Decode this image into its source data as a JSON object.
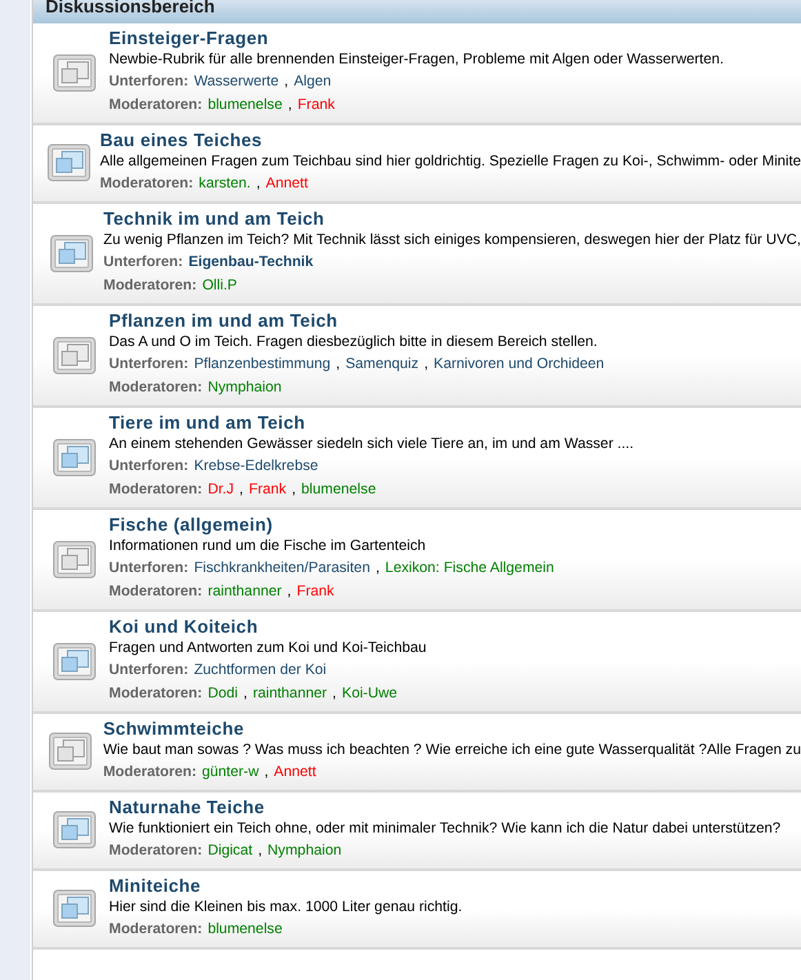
{
  "section": {
    "title": "Diskussionsbereich"
  },
  "separator": ",",
  "forums": [
    {
      "title": "Einsteiger-Fragen",
      "new_posts": false,
      "description": "Newbie-Rubrik für alle brennenden Einsteiger-Fragen, Probleme mit Algen oder Wasserwerten.",
      "subforums": {
        "label": "Unterforen:",
        "items": [
          {
            "name": "Wasserwerte",
            "color": "#1e4a6e",
            "bold": false
          },
          {
            "name": "Algen",
            "color": "#1e4a6e",
            "bold": false
          }
        ]
      },
      "moderators": {
        "label": "Moderatoren:",
        "items": [
          {
            "name": "blumenelse",
            "color": "#008000"
          },
          {
            "name": "Frank",
            "color": "#ff0000"
          }
        ]
      }
    },
    {
      "title": "Bau eines Teiches",
      "new_posts": true,
      "description": "Alle allgemeinen Fragen zum Teichbau sind hier goldrichtig. Spezielle Fragen zu Koi-, Schwimm- oder Minite",
      "moderators": {
        "label": "Moderatoren:",
        "items": [
          {
            "name": "karsten.",
            "color": "#008000"
          },
          {
            "name": "Annett",
            "color": "#ff0000"
          }
        ]
      }
    },
    {
      "title": "Technik im und am Teich",
      "new_posts": true,
      "description": "Zu wenig Pflanzen im Teich? Mit Technik lässt sich einiges kompensieren, deswegen hier der Platz für UVC,",
      "subforums": {
        "label": "Unterforen:",
        "items": [
          {
            "name": "Eigenbau-Technik",
            "color": "#1e4a6e",
            "bold": true
          }
        ]
      },
      "moderators": {
        "label": "Moderatoren:",
        "items": [
          {
            "name": "Olli.P",
            "color": "#008000"
          }
        ]
      }
    },
    {
      "title": "Pflanzen im und am Teich",
      "new_posts": false,
      "description": "Das A und O im Teich. Fragen diesbezüglich bitte in diesem Bereich stellen.",
      "subforums": {
        "label": "Unterforen:",
        "items": [
          {
            "name": "Pflanzenbestimmung",
            "color": "#1e4a6e",
            "bold": false
          },
          {
            "name": "Samenquiz",
            "color": "#1e4a6e",
            "bold": false
          },
          {
            "name": "Karnivoren und Orchideen",
            "color": "#1e4a6e",
            "bold": false
          }
        ]
      },
      "moderators": {
        "label": "Moderatoren:",
        "items": [
          {
            "name": "Nymphaion",
            "color": "#008000"
          }
        ]
      }
    },
    {
      "title": "Tiere im und am Teich",
      "new_posts": true,
      "description": "An einem stehenden Gewässer siedeln sich viele Tiere an, im und am Wasser ....",
      "subforums": {
        "label": "Unterforen:",
        "items": [
          {
            "name": "Krebse-Edelkrebse",
            "color": "#1e4a6e",
            "bold": false
          }
        ]
      },
      "moderators": {
        "label": "Moderatoren:",
        "items": [
          {
            "name": "Dr.J",
            "color": "#ff0000"
          },
          {
            "name": "Frank",
            "color": "#ff0000"
          },
          {
            "name": "blumenelse",
            "color": "#008000"
          }
        ]
      }
    },
    {
      "title": "Fische (allgemein)",
      "new_posts": false,
      "description": "Informationen rund um die Fische im Gartenteich",
      "subforums": {
        "label": "Unterforen:",
        "items": [
          {
            "name": "Fischkrankheiten/Parasiten",
            "color": "#1e4a6e",
            "bold": false
          },
          {
            "name": "Lexikon: Fische Allgemein",
            "color": "#008000",
            "bold": false
          }
        ]
      },
      "moderators": {
        "label": "Moderatoren:",
        "items": [
          {
            "name": "rainthanner",
            "color": "#008000"
          },
          {
            "name": "Frank",
            "color": "#ff0000"
          }
        ]
      }
    },
    {
      "title": "Koi und Koiteich",
      "new_posts": true,
      "description": "Fragen und Antworten zum Koi und Koi-Teichbau",
      "subforums": {
        "label": "Unterforen:",
        "items": [
          {
            "name": "Zuchtformen der Koi",
            "color": "#1e4a6e",
            "bold": false
          }
        ]
      },
      "moderators": {
        "label": "Moderatoren:",
        "items": [
          {
            "name": "Dodi",
            "color": "#008000"
          },
          {
            "name": "rainthanner",
            "color": "#008000"
          },
          {
            "name": "Koi-Uwe",
            "color": "#008000"
          }
        ]
      }
    },
    {
      "title": "Schwimmteiche",
      "new_posts": false,
      "description": "Wie baut man sowas ? Was muss ich beachten ? Wie erreiche ich eine gute Wasserqualität ?Alle Fragen zu",
      "moderators": {
        "label": "Moderatoren:",
        "items": [
          {
            "name": "günter-w",
            "color": "#008000"
          },
          {
            "name": "Annett",
            "color": "#ff0000"
          }
        ]
      }
    },
    {
      "title": "Naturnahe Teiche",
      "new_posts": true,
      "description": "Wie funktioniert ein Teich ohne, oder mit minimaler Technik? Wie kann ich die Natur dabei unterstützen?",
      "moderators": {
        "label": "Moderatoren:",
        "items": [
          {
            "name": "Digicat",
            "color": "#008000"
          },
          {
            "name": "Nymphaion",
            "color": "#008000"
          }
        ]
      }
    },
    {
      "title": "Miniteiche",
      "new_posts": true,
      "description": "Hier sind die Kleinen bis max. 1000 Liter genau richtig.",
      "moderators": {
        "label": "Moderatoren:",
        "items": [
          {
            "name": "blumenelse",
            "color": "#008000"
          }
        ]
      }
    }
  ]
}
